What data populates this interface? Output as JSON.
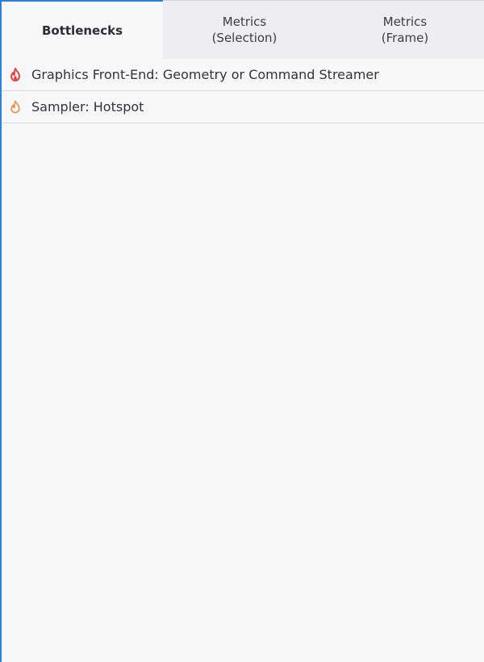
{
  "tabs": [
    {
      "label": "Bottlenecks",
      "active": true
    },
    {
      "label": "Metrics\n(Selection)",
      "active": false
    },
    {
      "label": "Metrics\n(Frame)",
      "active": false
    }
  ],
  "bottlenecks": [
    {
      "label": "Graphics Front-End: Geometry or Command Streamer",
      "icon": "flame-filled-icon",
      "color": "#e8413a"
    },
    {
      "label": "Sampler: Hotspot",
      "icon": "flame-outline-icon",
      "color": "#f08a3c"
    }
  ],
  "colors": {
    "accent": "#2f7fd6",
    "background": "#f6f7f9",
    "tab_inactive_bg": "#eceef1"
  }
}
